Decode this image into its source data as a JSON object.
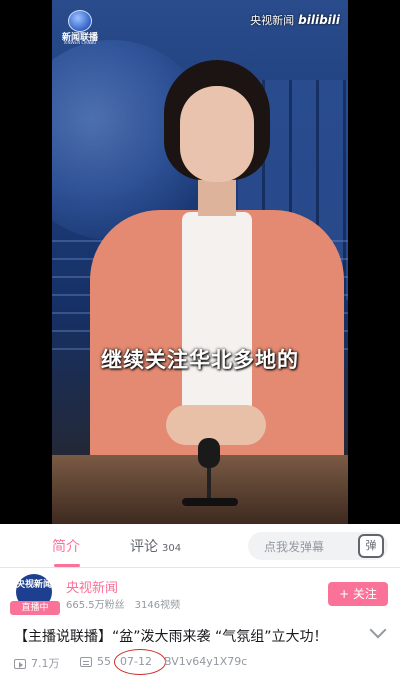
{
  "video": {
    "channel_logo_text": "新闻联播",
    "channel_logo_sub": "XINWEN LIANBO",
    "watermark_source": "央视新闻",
    "watermark_brand": "bilibili",
    "subtitle": "继续关注华北多地的"
  },
  "tabs": {
    "intro_label": "简介",
    "comments_label": "评论",
    "comments_count": "304"
  },
  "danmaku": {
    "placeholder": "点我发弹幕",
    "button_label": "弹"
  },
  "uploader": {
    "avatar_text": "央视新闻",
    "live_badge": "直播中",
    "name": "央视新闻",
    "fans": "665.5万粉丝",
    "videos": "3146视频",
    "follow_label": "+ 关注"
  },
  "video_info": {
    "title": "【主播说联播】“盆”泼大雨来袭 “气氛组”立大功！",
    "views": "7.1万",
    "danmaku_count": "55",
    "date": "07-12",
    "bvid": "BV1v64y1X79c"
  },
  "colors": {
    "accent": "#fb7299",
    "annotation_circle": "#c9302c"
  }
}
